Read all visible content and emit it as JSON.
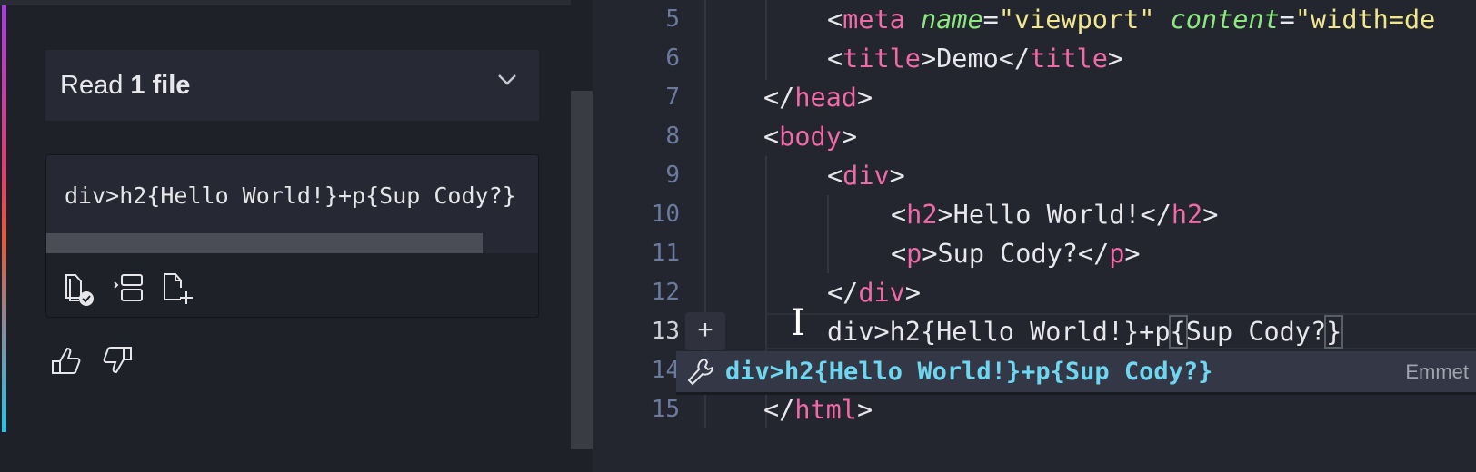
{
  "chat": {
    "read_prefix": "Read",
    "read_count": "1 file",
    "code_snippet": "div>h2{Hello World!}+p{Sup Cody?}",
    "actions": [
      "copy-icon",
      "insert-at-cursor-icon",
      "save-to-new-file-icon"
    ],
    "feedback": [
      "thumbs-up-icon",
      "thumbs-down-icon"
    ]
  },
  "editor": {
    "lines": [
      {
        "n": "5"
      },
      {
        "n": "6"
      },
      {
        "n": "7"
      },
      {
        "n": "8"
      },
      {
        "n": "9"
      },
      {
        "n": "10"
      },
      {
        "n": "11"
      },
      {
        "n": "12"
      },
      {
        "n": "13"
      },
      {
        "n": "14"
      },
      {
        "n": "15"
      }
    ],
    "tokens": {
      "l5": {
        "lt": "<",
        "tag": "meta",
        "attr1": "name",
        "eq1": "=",
        "val1": "\"viewport\"",
        "attr2": "content",
        "eq2": "=",
        "val2": "\"width=de"
      },
      "l6": {
        "open": "<",
        "tag": "title",
        "mid": ">Demo</",
        "tag2": "title",
        "close": ">"
      },
      "l7": {
        "open": "</",
        "tag": "head",
        "close": ">"
      },
      "l8": {
        "open": "<",
        "tag": "body",
        "close": ">"
      },
      "l9": {
        "open": "<",
        "tag": "div",
        "close": ">"
      },
      "l10": {
        "open": "<",
        "tag": "h2",
        "mid": ">Hello World!</",
        "tag2": "h2",
        "close": ">"
      },
      "l11": {
        "open": "<",
        "tag": "p",
        "mid": ">Sup Cody?</",
        "tag2": "p",
        "close": ">"
      },
      "l12": {
        "open": "</",
        "tag": "div",
        "close": ">"
      },
      "l13": {
        "a": "div>h2",
        "b": "{",
        "c": "Hello World!}+p",
        "d": "{",
        "e": "Sup Cody?",
        "f": "}"
      },
      "l15": {
        "open": "</",
        "tag": "html",
        "close": ">"
      }
    },
    "add_glyph": "+",
    "suggestion": {
      "text": "div>h2{Hello World!}+p{Sup Cody?}",
      "source": "Emmet"
    }
  }
}
